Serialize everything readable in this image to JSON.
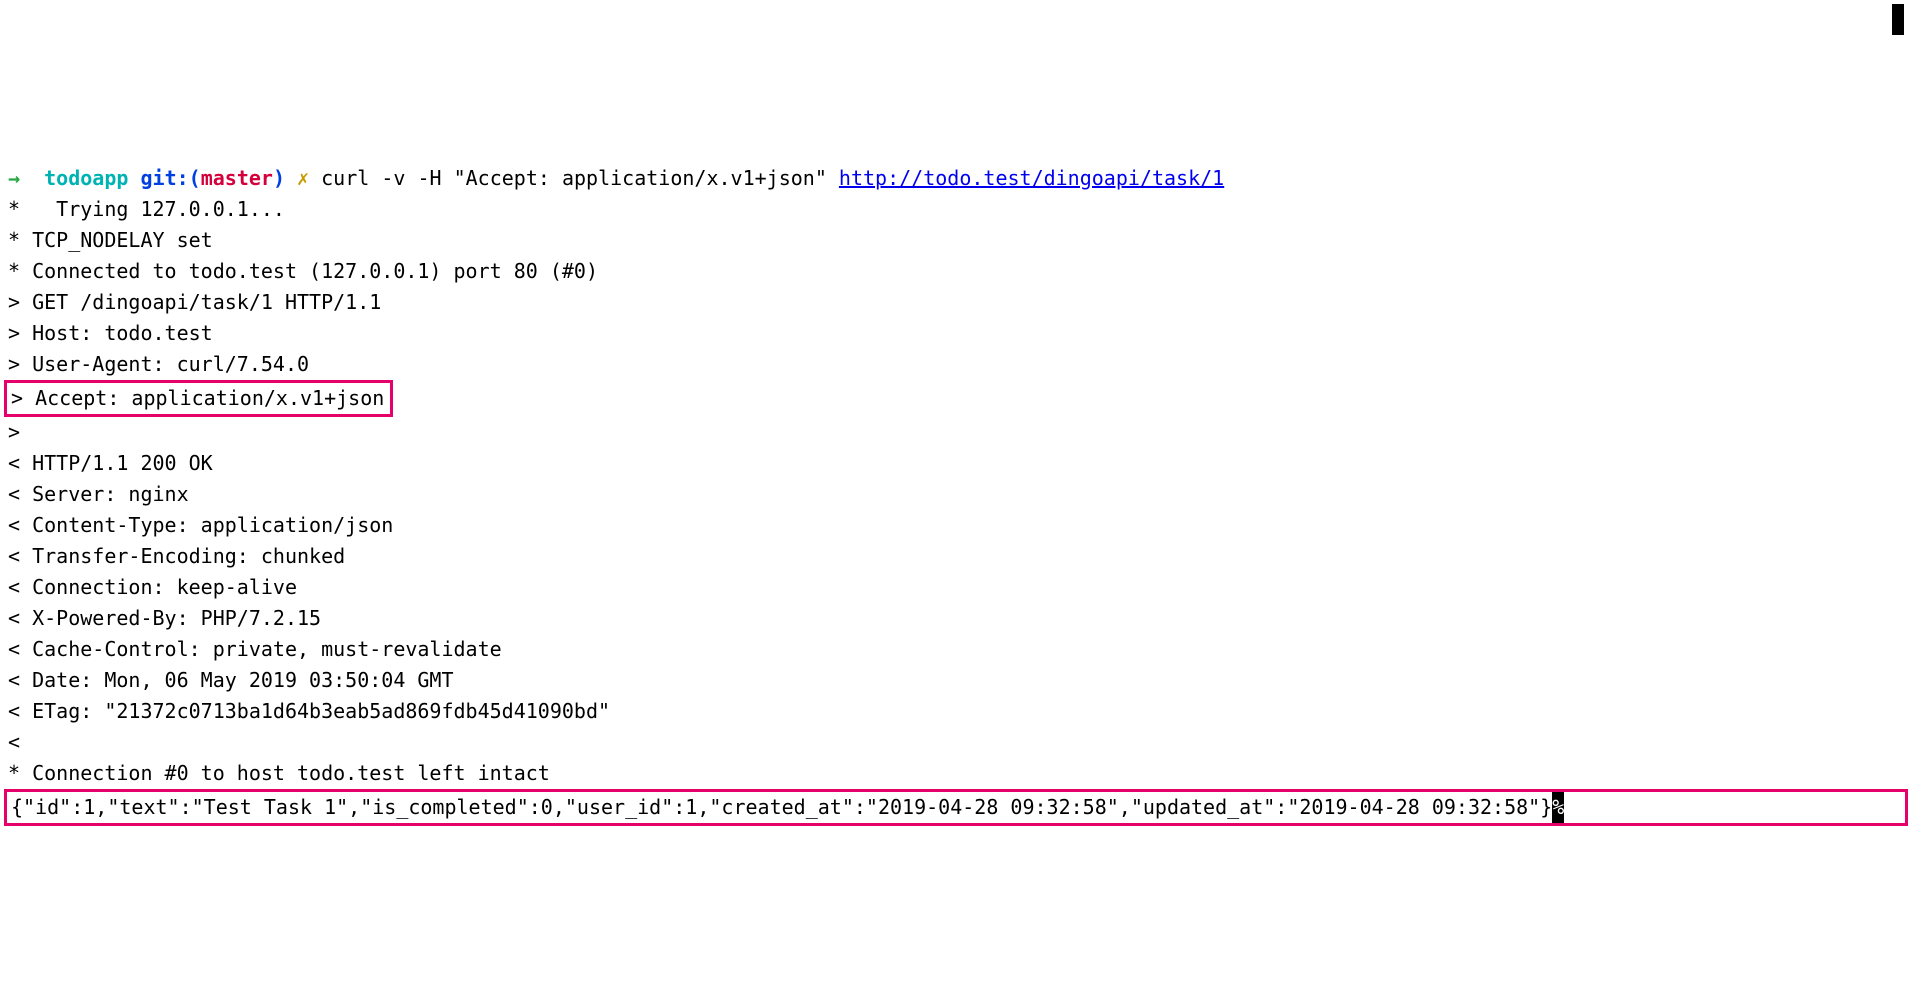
{
  "prompt": {
    "arrow": "→",
    "dir": "todoapp",
    "git_label": "git:",
    "git_paren_open": "(",
    "git_branch": "master",
    "git_paren_close": ")",
    "dirty": "✗",
    "cmd_prefix": "curl -v -H \"Accept: application/x.v1+json\" ",
    "cmd_url": "http://todo.test/dingoapi/task/1"
  },
  "lines": {
    "l01": "*   Trying 127.0.0.1...",
    "l02": "* TCP_NODELAY set",
    "l03": "* Connected to todo.test (127.0.0.1) port 80 (#0)",
    "l04": "> GET /dingoapi/task/1 HTTP/1.1",
    "l05": "> Host: todo.test",
    "l06": "> User-Agent: curl/7.54.0",
    "l07": "> Accept: application/x.v1+json",
    "l08": ">",
    "l09": "< HTTP/1.1 200 OK",
    "l10": "< Server: nginx",
    "l11": "< Content-Type: application/json",
    "l12": "< Transfer-Encoding: chunked",
    "l13": "< Connection: keep-alive",
    "l14": "< X-Powered-By: PHP/7.2.15",
    "l15": "< Cache-Control: private, must-revalidate",
    "l16": "< Date: Mon, 06 May 2019 03:50:04 GMT",
    "l17": "< ETag: \"21372c0713ba1d64b3eab5ad869fdb45d41090bd\"",
    "l18": "<",
    "l19": "* Connection #0 to host todo.test left intact",
    "l20": "{\"id\":1,\"text\":\"Test Task 1\",\"is_completed\":0,\"user_id\":1,\"created_at\":\"2019-04-28 09:32:58\",\"updated_at\":\"2019-04-28 09:32:58\"}",
    "pct": "%"
  }
}
